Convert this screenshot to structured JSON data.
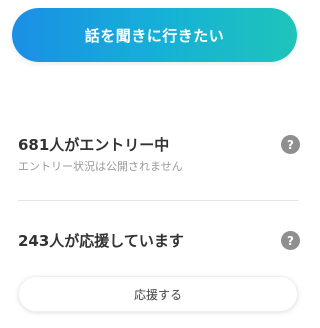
{
  "cta": {
    "label": "話を聞きに行きたい"
  },
  "entry": {
    "count_text": "681人がエントリー中",
    "note": "エントリー状況は公開されません",
    "help_icon_glyph": "?"
  },
  "support": {
    "count_text": "243人が応援しています",
    "help_icon_glyph": "?",
    "button_label": "応援する"
  },
  "colors": {
    "cta_gradient_start": "#1a8fe6",
    "cta_gradient_end": "#1fc4b9",
    "help_icon_bg": "#8f8f8f",
    "text_primary": "#333333",
    "text_muted": "#9a9a9a"
  },
  "icons": {
    "help": "help-icon"
  }
}
